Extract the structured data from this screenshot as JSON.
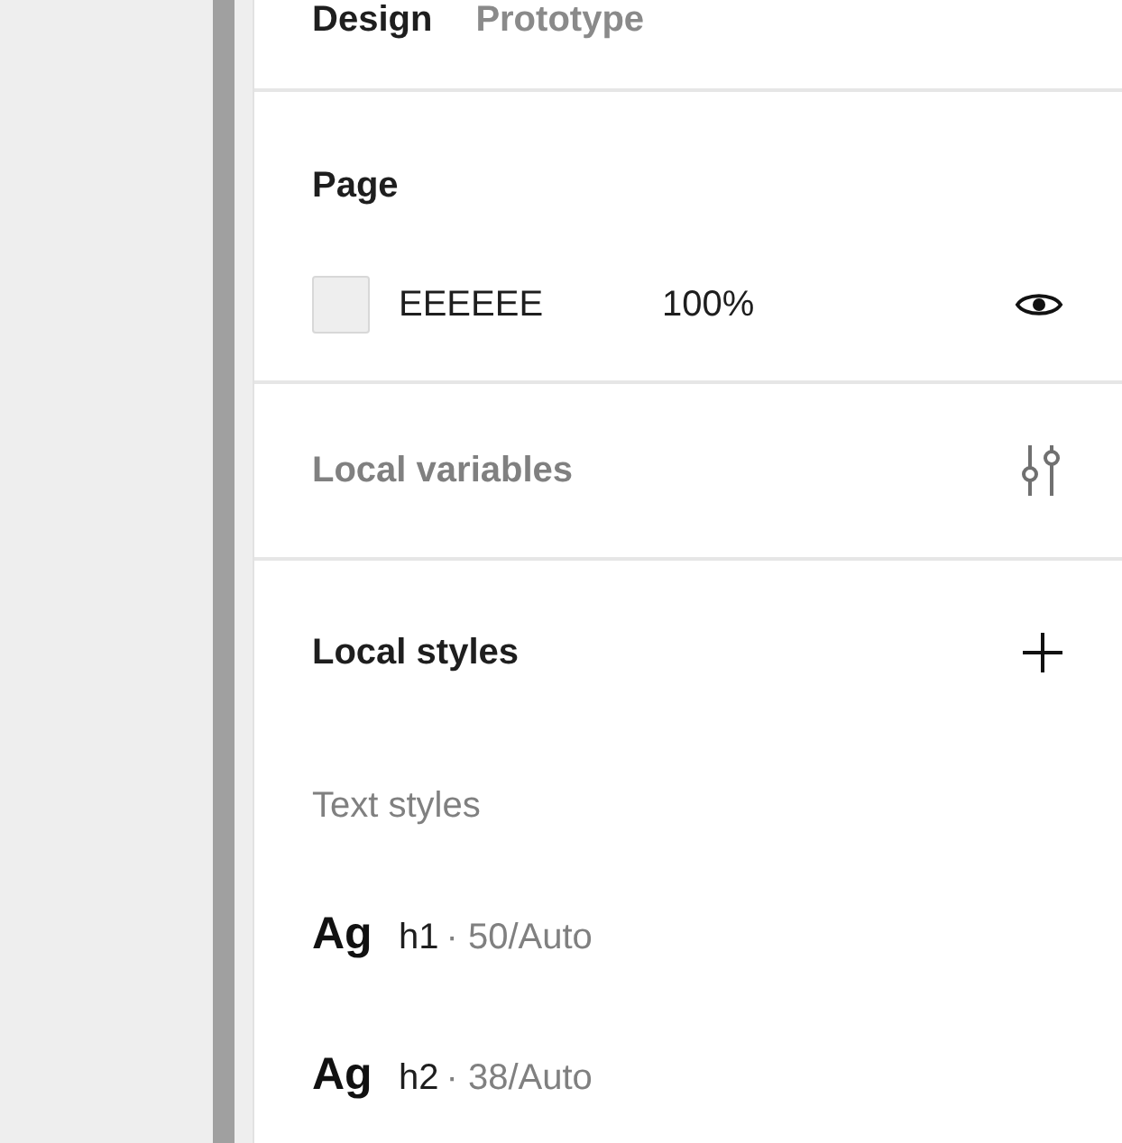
{
  "tabs": [
    {
      "label": "Design",
      "selected": true
    },
    {
      "label": "Prototype",
      "selected": false
    }
  ],
  "page": {
    "title": "Page",
    "fill": {
      "color": "#eeeeee",
      "hex": "EEEEEE",
      "opacity": "100%",
      "visible": true
    }
  },
  "local_variables": {
    "title": "Local variables",
    "disabled": true
  },
  "local_styles": {
    "title": "Local styles",
    "groups": [
      {
        "title": "Text styles",
        "items": [
          {
            "sample": "Ag",
            "name": "h1",
            "detail": "· 50/Auto"
          },
          {
            "sample": "Ag",
            "name": "h2",
            "detail": "· 38/Auto"
          }
        ]
      }
    ]
  }
}
